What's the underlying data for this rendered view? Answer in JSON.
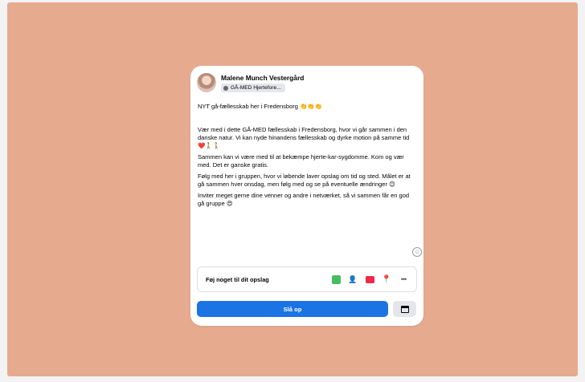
{
  "post_composer": {
    "author": "Malene Munch Vestergård",
    "audience": "GÅ-MED Hjertefore...",
    "paragraphs": [
      "NYT gå-fællesskab her i Fredensborg 👏👏👏",
      "",
      "Vær med i dette GÅ-MED fællesskab i Fredensborg, hvor vi går sammen i den danske natur. Vi kan nyde hinandens fællesskab og dyrke motion på samme tid ❤️🚶🚶",
      "Sammen kan vi være med til at bekæmpe hjerte-kar-sygdomme. Kom og vær med. Det er ganske gratis.",
      "Følg med her i gruppen, hvor vi løbende laver opslag om tid og sted. Målet er at gå sammen hver onsdag, men følg med og se på eventuelle ændringer 😊",
      "Inviter meget gerne dine venner og andre i netværket, så vi sammen får en god gå gruppe 😍"
    ],
    "add_to_post_label": "Føj noget til dit opslag",
    "more_label": "•••",
    "post_button": "Slå op",
    "icons": {
      "emoji": "emoji-icon",
      "photo": "photo-video-icon",
      "tag": "tag-people-icon",
      "live": "live-video-icon",
      "location": "check-in-icon",
      "more": "more-icon",
      "schedule": "calendar-icon"
    }
  },
  "colors": {
    "background_outer": "#f3f3f4",
    "canvas": "#e6aa8f",
    "card": "#ffffff",
    "primary_button": "#1b74e4",
    "photo_green": "#45bd62",
    "tag_blue": "#1877f2",
    "live_red": "#f02849",
    "location_orange": "#f5533d"
  }
}
